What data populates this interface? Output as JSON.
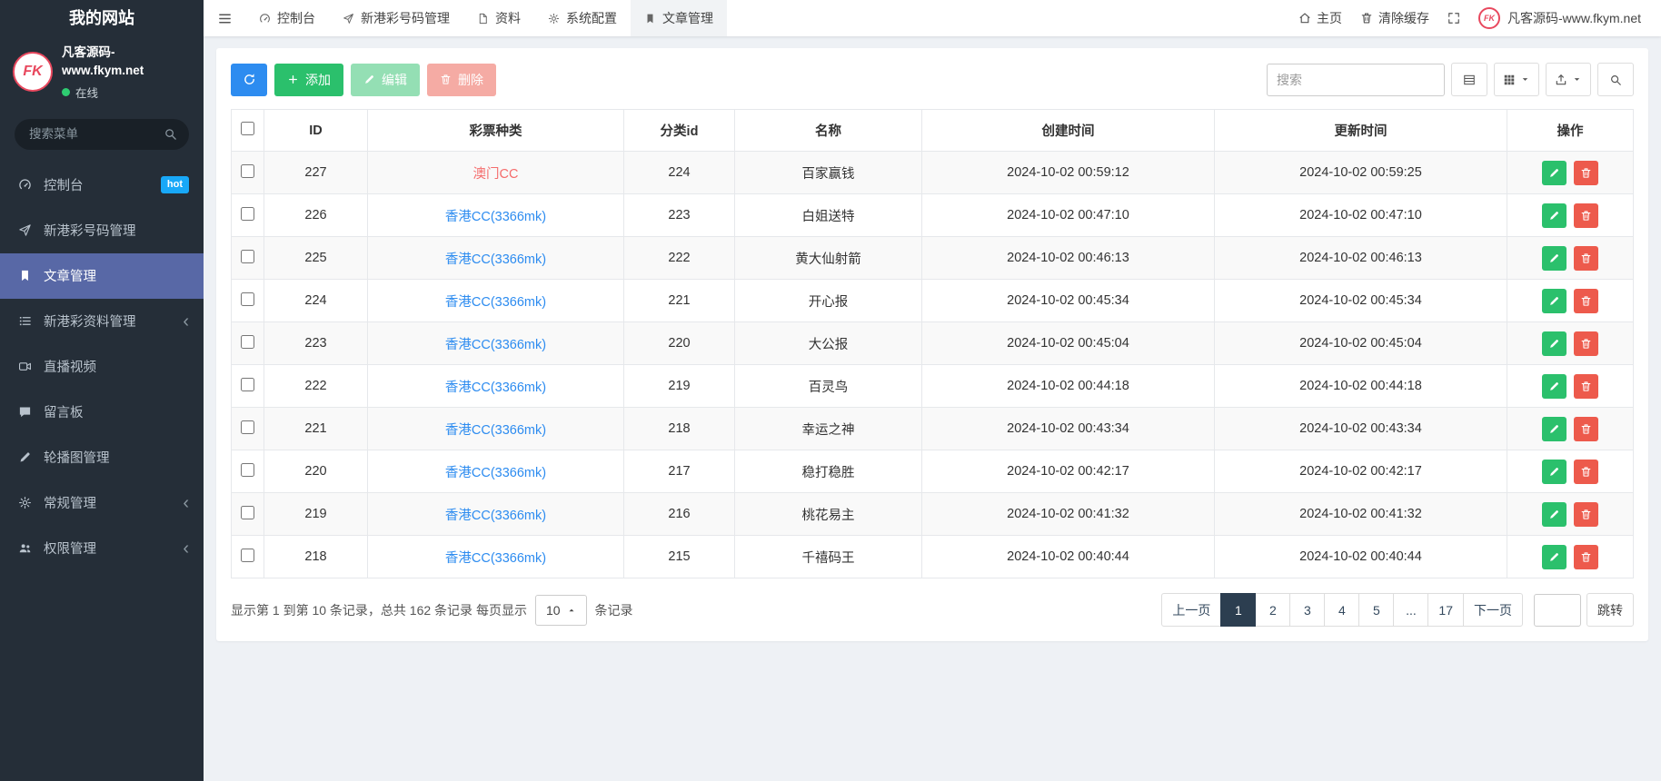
{
  "app": {
    "site_title": "我的网站",
    "brand": {
      "logo_text": "FK",
      "name": "凡客源码-www.fkym.net",
      "status": "在线"
    }
  },
  "colors": {
    "sidebar_bg": "#252e38",
    "active_menu": "#5868a6",
    "hot_badge": "#18a8f8",
    "accent_blue": "#2d8cf0",
    "success_green": "#2bc06c",
    "danger_red": "#ed5a4c",
    "link_red": "#f56c6c",
    "pager_active": "#2c3e50",
    "online_dot": "#2ecc71"
  },
  "sidebar": {
    "search_placeholder": "搜索菜单",
    "items": [
      {
        "label": "控制台",
        "icon": "gauge-icon",
        "badge": "hot"
      },
      {
        "label": "新港彩号码管理",
        "icon": "paper-plane-icon"
      },
      {
        "label": "文章管理",
        "icon": "bookmark-icon",
        "active": true
      },
      {
        "label": "新港彩资料管理",
        "icon": "list-icon",
        "expandable": true
      },
      {
        "label": "直播视频",
        "icon": "video-icon"
      },
      {
        "label": "留言板",
        "icon": "comment-icon"
      },
      {
        "label": "轮播图管理",
        "icon": "pencil-icon"
      },
      {
        "label": "常规管理",
        "icon": "gears-icon",
        "expandable": true
      },
      {
        "label": "权限管理",
        "icon": "users-icon",
        "expandable": true
      }
    ]
  },
  "topbar": {
    "tabs": [
      {
        "label": "控制台",
        "icon": "gauge-icon"
      },
      {
        "label": "新港彩号码管理",
        "icon": "paper-plane-icon"
      },
      {
        "label": "资料",
        "icon": "file-icon"
      },
      {
        "label": "系统配置",
        "icon": "gear-icon"
      },
      {
        "label": "文章管理",
        "icon": "bookmark-icon",
        "active": true
      }
    ],
    "right": {
      "home": "主页",
      "clear_cache": "清除缓存",
      "fullscreen_icon": "fullscreen-icon",
      "brand": "凡客源码-www.fkym.net"
    }
  },
  "toolbar": {
    "refresh_icon": "refresh-icon",
    "add": "添加",
    "edit": "编辑",
    "delete": "删除",
    "search_placeholder": "搜索",
    "view_buttons": [
      "toggle-view-icon",
      "columns-grid-icon",
      "export-icon",
      "search-icon"
    ]
  },
  "table": {
    "columns": [
      "ID",
      "彩票种类",
      "分类id",
      "名称",
      "创建时间",
      "更新时间",
      "操作"
    ],
    "rows": [
      {
        "id": "227",
        "lottery": "澳门CC",
        "link_style": "red",
        "category_id": "224",
        "name": "百家赢钱",
        "created": "2024-10-02 00:59:12",
        "updated": "2024-10-02 00:59:25"
      },
      {
        "id": "226",
        "lottery": "香港CC(3366mk)",
        "link_style": "blue",
        "category_id": "223",
        "name": "白姐送特",
        "created": "2024-10-02 00:47:10",
        "updated": "2024-10-02 00:47:10"
      },
      {
        "id": "225",
        "lottery": "香港CC(3366mk)",
        "link_style": "blue",
        "category_id": "222",
        "name": "黄大仙射箭",
        "created": "2024-10-02 00:46:13",
        "updated": "2024-10-02 00:46:13"
      },
      {
        "id": "224",
        "lottery": "香港CC(3366mk)",
        "link_style": "blue",
        "category_id": "221",
        "name": "开心报",
        "created": "2024-10-02 00:45:34",
        "updated": "2024-10-02 00:45:34"
      },
      {
        "id": "223",
        "lottery": "香港CC(3366mk)",
        "link_style": "blue",
        "category_id": "220",
        "name": "大公报",
        "created": "2024-10-02 00:45:04",
        "updated": "2024-10-02 00:45:04"
      },
      {
        "id": "222",
        "lottery": "香港CC(3366mk)",
        "link_style": "blue",
        "category_id": "219",
        "name": "百灵鸟",
        "created": "2024-10-02 00:44:18",
        "updated": "2024-10-02 00:44:18"
      },
      {
        "id": "221",
        "lottery": "香港CC(3366mk)",
        "link_style": "blue",
        "category_id": "218",
        "name": "幸运之神",
        "created": "2024-10-02 00:43:34",
        "updated": "2024-10-02 00:43:34"
      },
      {
        "id": "220",
        "lottery": "香港CC(3366mk)",
        "link_style": "blue",
        "category_id": "217",
        "name": "稳打稳胜",
        "created": "2024-10-02 00:42:17",
        "updated": "2024-10-02 00:42:17"
      },
      {
        "id": "219",
        "lottery": "香港CC(3366mk)",
        "link_style": "blue",
        "category_id": "216",
        "name": "桃花易主",
        "created": "2024-10-02 00:41:32",
        "updated": "2024-10-02 00:41:32"
      },
      {
        "id": "218",
        "lottery": "香港CC(3366mk)",
        "link_style": "blue",
        "category_id": "215",
        "name": "千禧码王",
        "created": "2024-10-02 00:40:44",
        "updated": "2024-10-02 00:40:44"
      }
    ]
  },
  "footer": {
    "records_summary": "显示第 1 到第 10 条记录，总共 162 条记录 每页显示",
    "page_size": "10",
    "per_page_suffix": "条记录"
  },
  "pagination": {
    "prev": "上一页",
    "next": "下一页",
    "pages": [
      "1",
      "2",
      "3",
      "4",
      "5",
      "...",
      "17"
    ],
    "active_page": "1",
    "jump": "跳转"
  }
}
